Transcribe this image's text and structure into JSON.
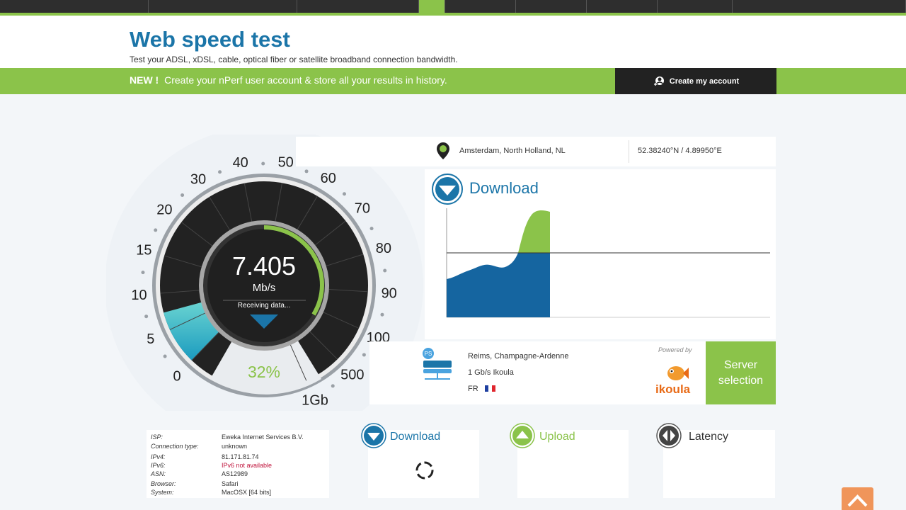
{
  "topnav": {
    "items": [
      "",
      "",
      "",
      "",
      "",
      "",
      "",
      "",
      ""
    ]
  },
  "header": {
    "title": "Web speed test",
    "subtitle": "Test your ADSL, xDSL, cable, optical fiber or satellite broadband connection bandwidth."
  },
  "promo": {
    "new_label": "NEW !",
    "text": "Create your nPerf user account & store all your results in history.",
    "button_label": "Create my account"
  },
  "gauge": {
    "speed": "7.405",
    "unit": "Mb/s",
    "status": "Receiving data...",
    "percent": "32%",
    "progress_fraction": 0.32,
    "scale_labels": [
      "0",
      "5",
      "10",
      "15",
      "20",
      "30",
      "40",
      "50",
      "60",
      "70",
      "80",
      "90",
      "100",
      "500",
      "1Gb"
    ]
  },
  "location": {
    "city": "Amsterdam, North Holland, NL",
    "coords": "52.38240°N / 4.89950°E"
  },
  "download_panel": {
    "label": "Download"
  },
  "server": {
    "city": "Reims, Champagne-Ardenne",
    "isp": "1 Gb/s Ikoula",
    "country": "FR",
    "powered_by": "Powered by",
    "provider_logo": "ikoula",
    "button_label": "Server selection",
    "flag_colors": [
      "#1e3fa0",
      "#ffffff",
      "#e0262e"
    ]
  },
  "info": {
    "rows": [
      {
        "k": "ISP:",
        "v": "Eweka Internet Services B.V."
      },
      {
        "k": "Connection type:",
        "v": "unknown"
      },
      {
        "k": "IPv4:",
        "v": "81.171.81.74"
      },
      {
        "k": "IPv6:",
        "v": "IPv6 not available"
      },
      {
        "k": "ASN:",
        "v": "AS12989"
      },
      {
        "k": "Browser:",
        "v": "Safari"
      },
      {
        "k": "System:",
        "v": "MacOSX [64 bits]"
      }
    ]
  },
  "cards": {
    "download": "Download",
    "upload": "Upload",
    "latency": "Latency"
  },
  "colors": {
    "accent_green": "#8bc34a",
    "brand_blue": "#1b75a8",
    "dark": "#222222",
    "scroll_button": "#f0955a"
  }
}
